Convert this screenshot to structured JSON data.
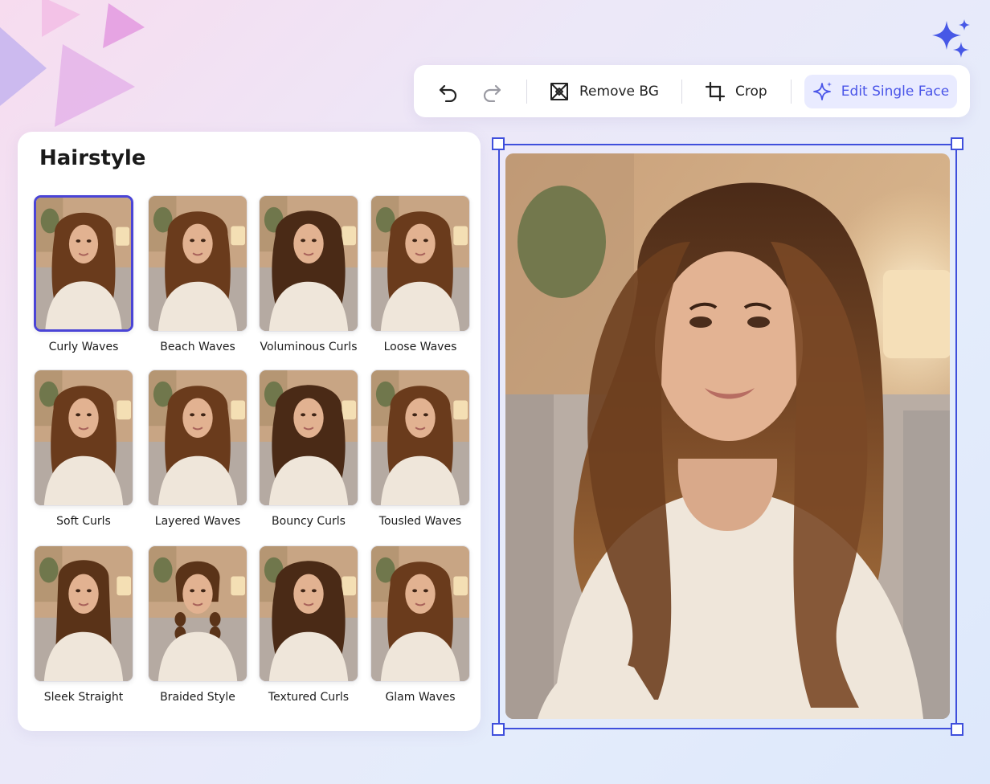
{
  "toolbar": {
    "undo_icon": "undo-icon",
    "redo_icon": "redo-icon",
    "remove_bg_label": "Remove BG",
    "remove_bg_icon": "remove-background-icon",
    "crop_label": "Crop",
    "crop_icon": "crop-icon",
    "edit_single_face_label": "Edit Single Face",
    "edit_single_face_icon": "sparkle-icon"
  },
  "panel": {
    "title": "Hairstyle",
    "selected": "Curly Waves",
    "items": [
      {
        "label": "Curly Waves",
        "selected": true
      },
      {
        "label": "Beach Waves"
      },
      {
        "label": "Voluminous Curls"
      },
      {
        "label": "Loose Waves"
      },
      {
        "label": "Soft Curls"
      },
      {
        "label": "Layered Waves"
      },
      {
        "label": "Bouncy Curls"
      },
      {
        "label": "Tousled Waves"
      },
      {
        "label": "Sleek Straight"
      },
      {
        "label": "Braided Style"
      },
      {
        "label": "Textured Curls"
      },
      {
        "label": "Glam Waves"
      }
    ]
  },
  "colors": {
    "accent": "#4a44d6",
    "accent_soft": "#e9ebff",
    "selection_frame": "#3f4fdc"
  },
  "decor": {
    "top_left": "play-triangles-decoration",
    "top_right": "sparkle-icon"
  }
}
